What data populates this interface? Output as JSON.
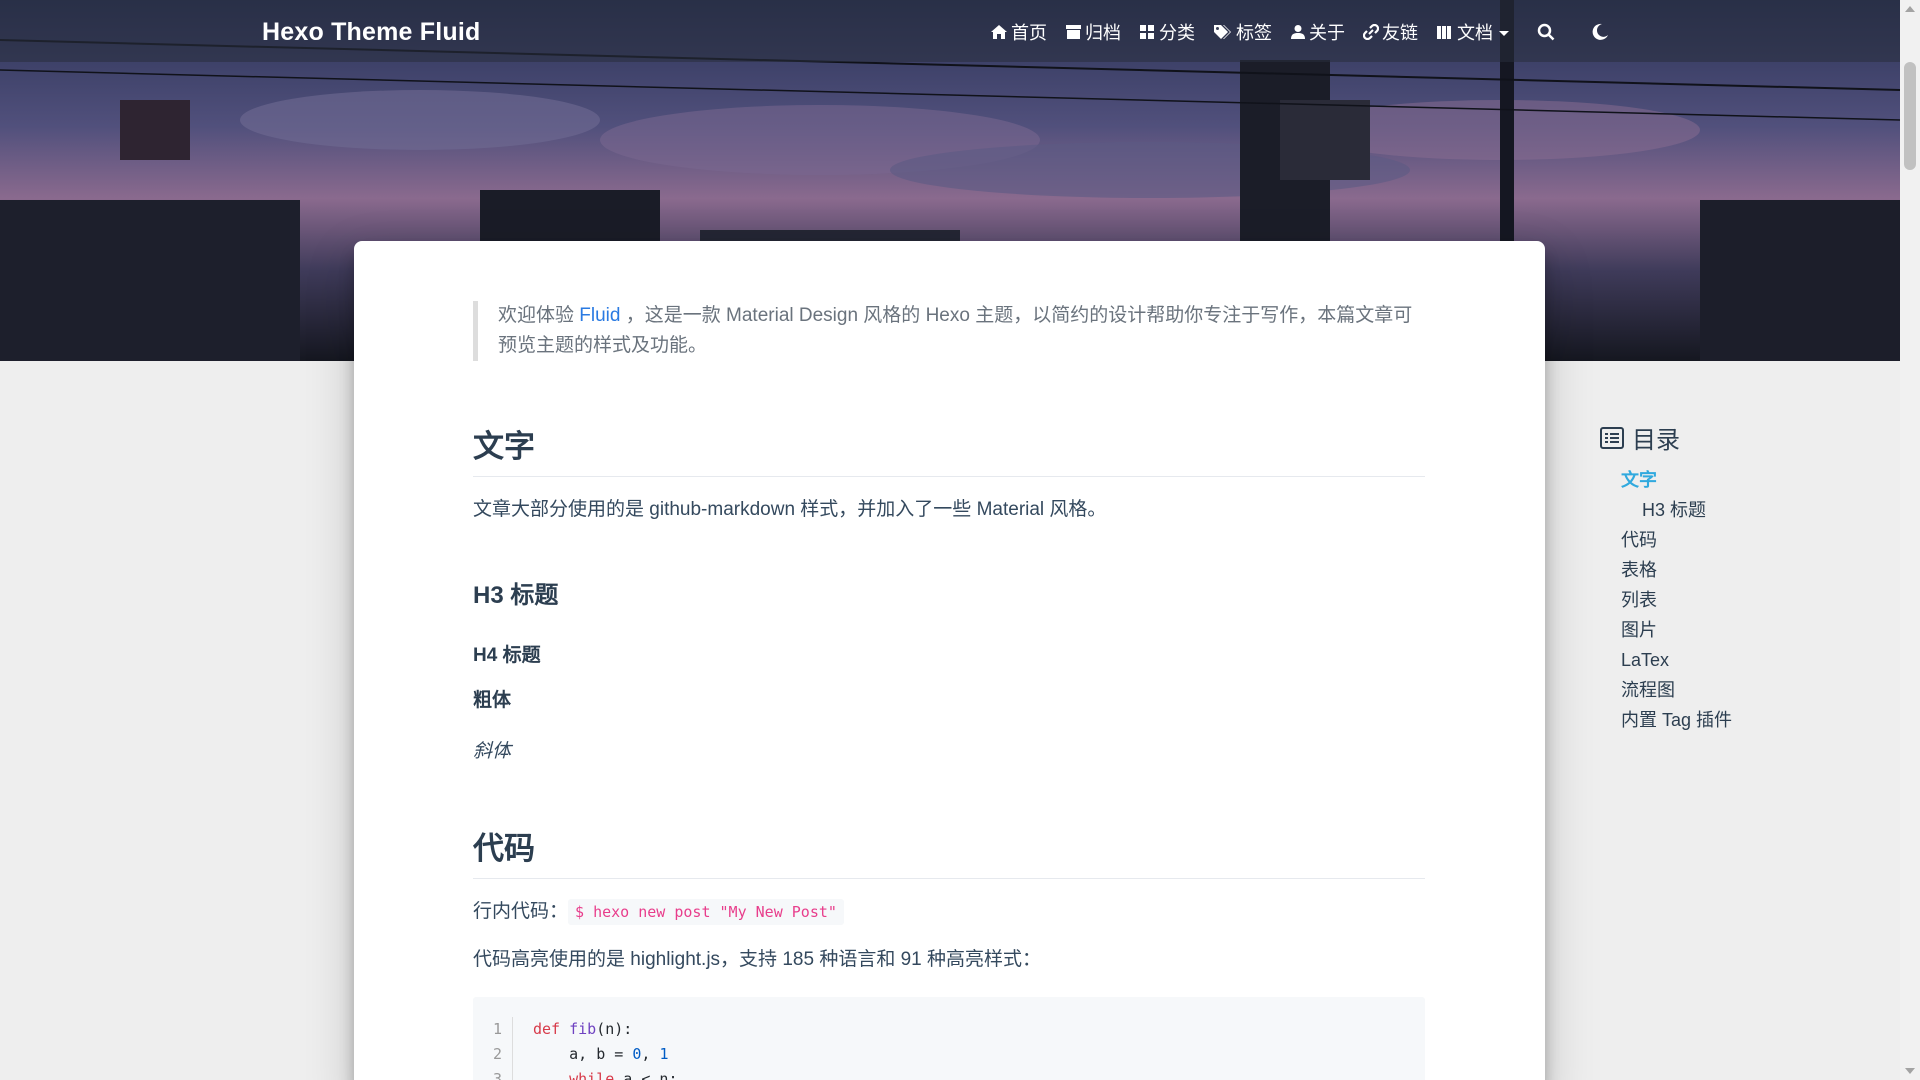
{
  "navbar": {
    "brand": "Hexo Theme Fluid",
    "items": [
      {
        "label": "首页",
        "icon": "home-icon"
      },
      {
        "label": "归档",
        "icon": "archive-icon"
      },
      {
        "label": "分类",
        "icon": "category-icon"
      },
      {
        "label": "标签",
        "icon": "tag-icon"
      },
      {
        "label": "关于",
        "icon": "user-icon"
      },
      {
        "label": "友链",
        "icon": "link-icon"
      },
      {
        "label": "文档",
        "icon": "book-icon"
      }
    ],
    "search_icon": "search-icon",
    "dark_mode_icon": "moon-icon"
  },
  "article": {
    "quote_prefix": "欢迎体验 ",
    "quote_link": "Fluid",
    "quote_suffix": " ，这是一款 Material Design 风格的 Hexo 主题，以简约的设计帮助你专注于写作，本篇文章可预览主题的样式及功能。",
    "h2_text": "文字",
    "p_text": "文章大部分使用的是 github-markdown 样式，并加入了一些 Material 风格。",
    "h3": "H3 标题",
    "h4": "H4 标题",
    "bold": "粗体",
    "italic": "斜体",
    "h2_code": "代码",
    "inline_label": "行内代码：",
    "inline_code": "$ hexo new post \"My New Post\"",
    "highlight_text": "代码高亮使用的是 highlight.js，支持 185 种语言和 91 种高亮样式：",
    "code_lines": [
      "1",
      "2",
      "3"
    ]
  },
  "toc": {
    "title": "目录",
    "items": [
      {
        "label": "文字",
        "active": true
      },
      {
        "label": "H3 标题"
      },
      {
        "label": "代码"
      },
      {
        "label": "表格"
      },
      {
        "label": "列表"
      },
      {
        "label": "图片"
      },
      {
        "label": "LaTex"
      },
      {
        "label": "流程图"
      },
      {
        "label": "内置 Tag 插件"
      }
    ]
  },
  "colors": {
    "accent": "#30a9de",
    "link": "#2a7ae2",
    "inline_code": "#e83e8c"
  }
}
